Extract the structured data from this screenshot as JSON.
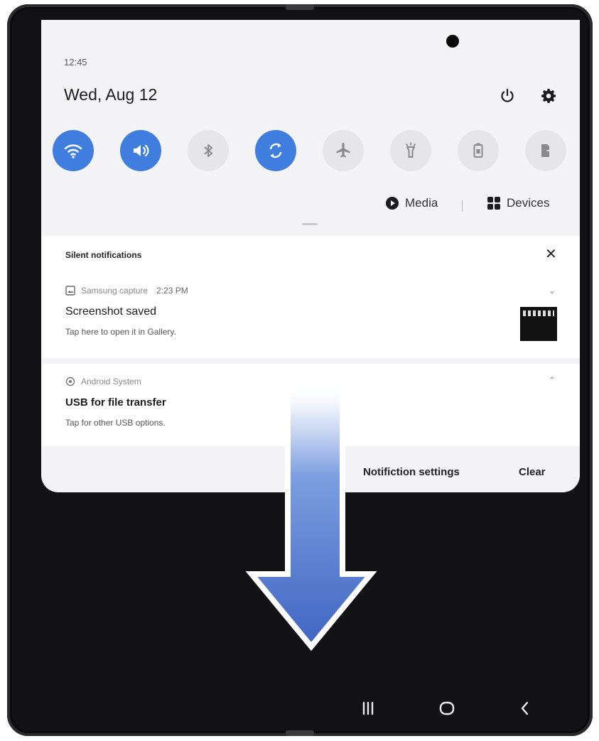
{
  "status": {
    "time": "12:45",
    "date": "Wed, Aug 12"
  },
  "header": {
    "power_icon": "power-icon",
    "settings_icon": "gear-icon"
  },
  "quick_settings": [
    {
      "name": "wifi-icon",
      "state": "on"
    },
    {
      "name": "sound-icon",
      "state": "on"
    },
    {
      "name": "bluetooth-icon",
      "state": "off"
    },
    {
      "name": "auto-rotate-icon",
      "state": "on"
    },
    {
      "name": "airplane-icon",
      "state": "off"
    },
    {
      "name": "flashlight-icon",
      "state": "off"
    },
    {
      "name": "power-saving-icon",
      "state": "off"
    },
    {
      "name": "device-share-icon",
      "state": "off"
    }
  ],
  "media_bar": {
    "media_label": "Media",
    "devices_label": "Devices"
  },
  "silent": {
    "label": "Silent notifications"
  },
  "notifications": {
    "screenshot": {
      "app": "Samsung capture",
      "time": "2:23 PM",
      "title": "Screenshot saved",
      "body": "Tap here to open it in Gallery."
    },
    "usb": {
      "app": "Android System",
      "title": "USB for file transfer",
      "body": "Tap for other USB options."
    }
  },
  "footer": {
    "settings_label": "Notifiction settings",
    "clear_label": "Clear"
  },
  "colors": {
    "accent": "#3f7ddf",
    "arrow": "#4a72c8",
    "frame": "#121214"
  }
}
